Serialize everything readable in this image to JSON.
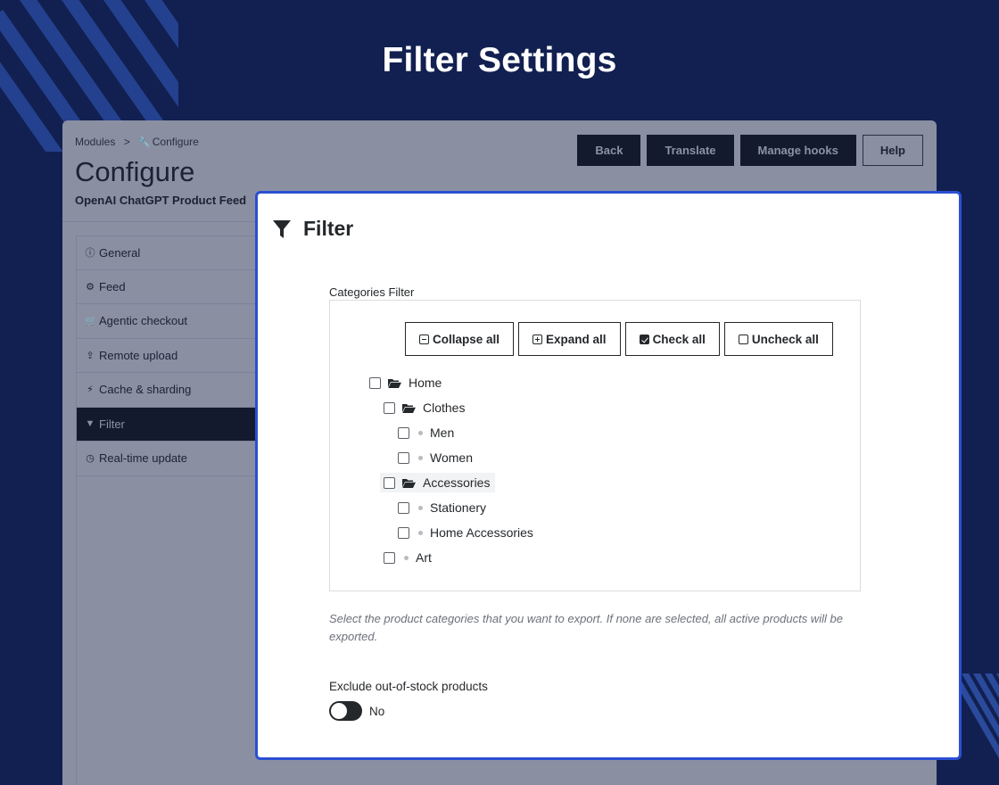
{
  "hero": {
    "title": "Filter Settings"
  },
  "breadcrumb": {
    "parent": "Modules",
    "separator": ">",
    "current": "Configure"
  },
  "page": {
    "title": "Configure",
    "subtitle": "OpenAI ChatGPT Product Feed"
  },
  "toolbar": {
    "back": "Back",
    "translate": "Translate",
    "manage_hooks": "Manage hooks",
    "help": "Help"
  },
  "sidebar": {
    "items": [
      {
        "label": "General",
        "icon": "info-circle-icon"
      },
      {
        "label": "Feed",
        "icon": "cogs-icon"
      },
      {
        "label": "Agentic checkout",
        "icon": "cart-icon"
      },
      {
        "label": "Remote upload",
        "icon": "upload-icon"
      },
      {
        "label": "Cache & sharding",
        "icon": "bolt-icon"
      },
      {
        "label": "Filter",
        "icon": "funnel-icon",
        "active": true
      },
      {
        "label": "Real-time update",
        "icon": "clock-icon"
      }
    ]
  },
  "filter": {
    "title": "Filter",
    "categories_label": "Categories Filter",
    "actions": {
      "collapse_all": "Collapse all",
      "expand_all": "Expand all",
      "check_all": "Check all",
      "uncheck_all": "Uncheck all"
    },
    "tree": [
      {
        "label": "Home",
        "type": "folder",
        "level": 0
      },
      {
        "label": "Clothes",
        "type": "folder",
        "level": 1
      },
      {
        "label": "Men",
        "type": "leaf",
        "level": 2
      },
      {
        "label": "Women",
        "type": "leaf",
        "level": 2
      },
      {
        "label": "Accessories",
        "type": "folder",
        "level": 1
      },
      {
        "label": "Stationery",
        "type": "leaf",
        "level": 2
      },
      {
        "label": "Home Accessories",
        "type": "leaf",
        "level": 2
      },
      {
        "label": "Art",
        "type": "leaf",
        "level": 1
      }
    ],
    "help_text": "Select the product categories that you want to export. If none are selected, all active products will be exported.",
    "out_of_stock": {
      "label": "Exclude out-of-stock products",
      "state": "No"
    }
  },
  "colors": {
    "background": "#112050",
    "accent": "#2a4fd3",
    "dark": "#131a2e"
  }
}
